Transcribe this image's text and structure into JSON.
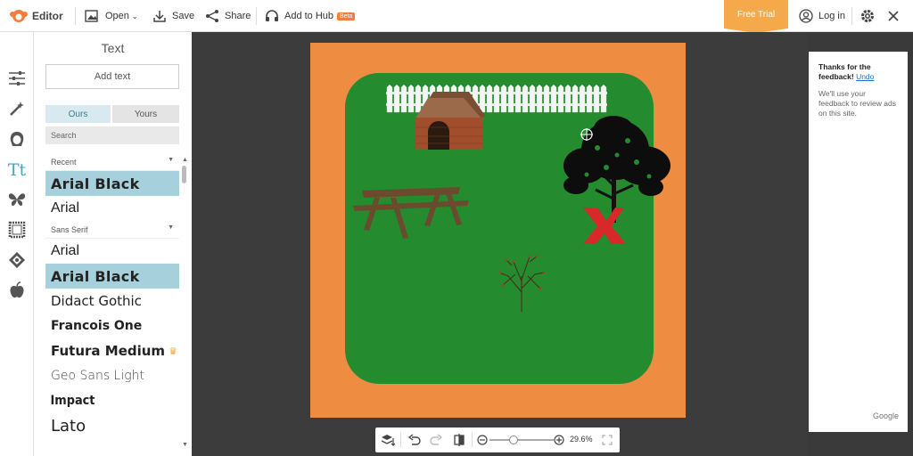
{
  "topbar": {
    "app_name": "Editor",
    "open_label": "Open",
    "save_label": "Save",
    "share_label": "Share",
    "hub_label": "Add to Hub",
    "beta_badge": "Beta",
    "free_trial_label": "Free Trial",
    "login_label": "Log in"
  },
  "rail": {
    "icons": [
      "sliders-icon",
      "magic-wand-icon",
      "face-icon",
      "text-icon",
      "butterfly-icon",
      "frame-icon",
      "texture-icon",
      "apple-icon"
    ],
    "active": "text-icon"
  },
  "text_panel": {
    "title": "Text",
    "add_text_label": "Add text",
    "tab_ours": "Ours",
    "tab_yours": "Yours",
    "active_tab": "Ours",
    "search_placeholder": "Search",
    "fonts": [
      {
        "kind": "header",
        "label": "Recent"
      },
      {
        "kind": "font",
        "label": "Arial Black",
        "selected": true
      },
      {
        "kind": "font",
        "label": "Arial"
      },
      {
        "kind": "header",
        "label": "Sans Serif"
      },
      {
        "kind": "font",
        "label": "Arial"
      },
      {
        "kind": "font",
        "label": "Arial Black",
        "selected": true
      },
      {
        "kind": "font",
        "label": "Didact Gothic"
      },
      {
        "kind": "font",
        "label": "Francois One"
      },
      {
        "kind": "font",
        "label": "Futura Medium",
        "premium": true
      },
      {
        "kind": "font",
        "label": "Geo Sans Light"
      },
      {
        "kind": "font",
        "label": "Impact"
      },
      {
        "kind": "font",
        "label": "Lato"
      }
    ]
  },
  "canvas": {
    "board_color": "#ee8d42",
    "grass_color": "#248b2e"
  },
  "bottom_toolbar": {
    "zoom_label": "29.6%"
  },
  "ad": {
    "title": "Thanks for the feedback!",
    "undo_label": "Undo",
    "body": "We'll use your feedback to review ads on this site.",
    "brand": "Google"
  },
  "colors": {
    "accent_orange": "#f47c3c",
    "selected_font_bg": "#a7d0dd",
    "free_trial": "#f6a94b"
  }
}
